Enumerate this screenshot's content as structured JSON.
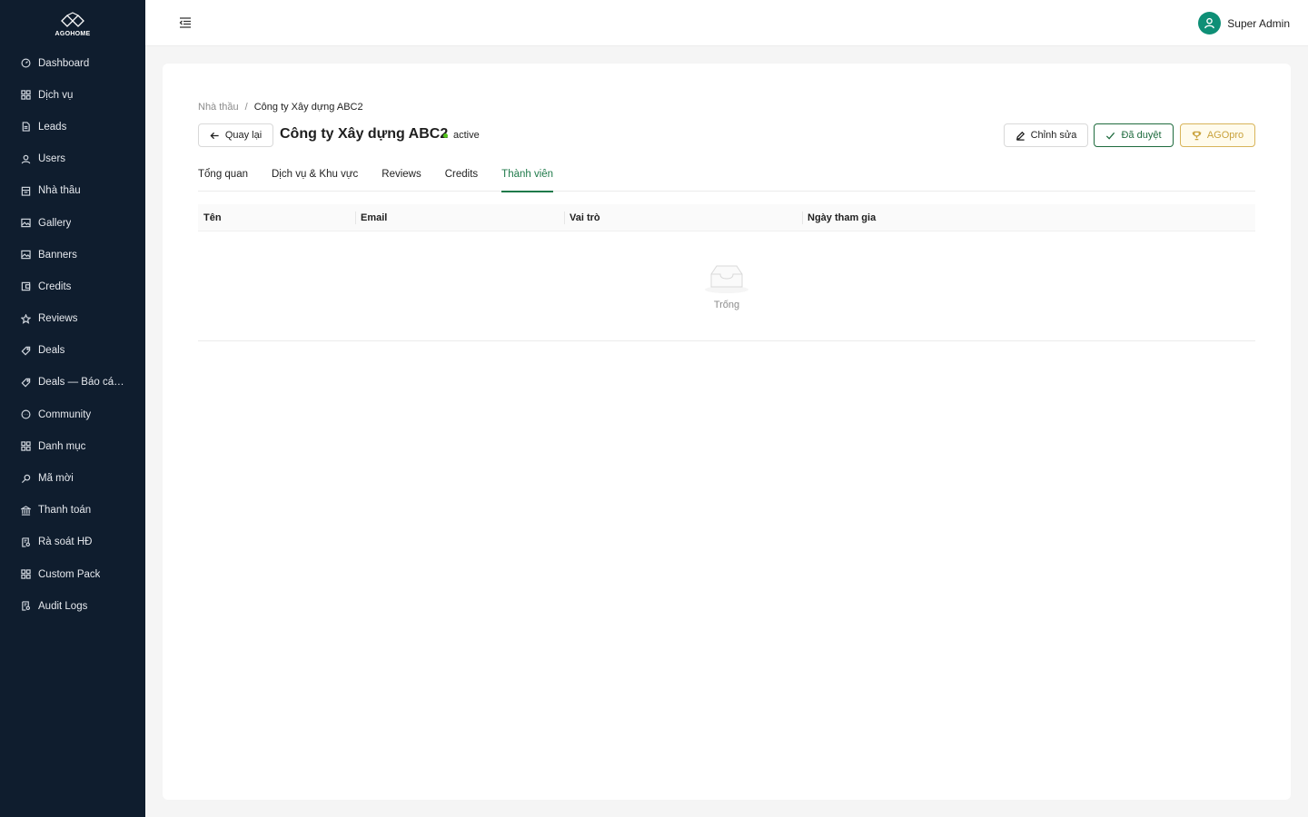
{
  "brand": {
    "name": "AGOHOME"
  },
  "sidebar": {
    "items": [
      {
        "label": "Dashboard",
        "icon": "dashboard-icon"
      },
      {
        "label": "Dịch vụ",
        "icon": "grid-icon"
      },
      {
        "label": "Leads",
        "icon": "file-icon"
      },
      {
        "label": "Users",
        "icon": "user-icon"
      },
      {
        "label": "Nhà thầu",
        "icon": "building-icon"
      },
      {
        "label": "Gallery",
        "icon": "image-icon"
      },
      {
        "label": "Banners",
        "icon": "image-icon"
      },
      {
        "label": "Credits",
        "icon": "wallet-icon"
      },
      {
        "label": "Reviews",
        "icon": "star-icon"
      },
      {
        "label": "Deals",
        "icon": "tag-icon"
      },
      {
        "label": "Deals — Báo cáo ...",
        "icon": "tag-icon"
      },
      {
        "label": "Community",
        "icon": "chat-icon"
      },
      {
        "label": "Danh mục",
        "icon": "grid-icon"
      },
      {
        "label": "Mã mời",
        "icon": "key-icon"
      },
      {
        "label": "Thanh toán",
        "icon": "bank-icon"
      },
      {
        "label": "Rà soát HĐ",
        "icon": "audit-icon"
      },
      {
        "label": "Custom Pack",
        "icon": "grid-icon"
      },
      {
        "label": "Audit Logs",
        "icon": "audit-icon"
      }
    ]
  },
  "header": {
    "user_name": "Super Admin"
  },
  "breadcrumb": {
    "parent": "Nhà thầu",
    "separator": "/",
    "current": "Công ty Xây dựng ABC2"
  },
  "page": {
    "back_label": "Quay lại",
    "title": "Công ty Xây dựng ABC2",
    "status": "active",
    "status_color": "#52c41a",
    "actions": {
      "edit": "Chỉnh sửa",
      "approved": "Đã duyệt",
      "agopro": "AGOpro"
    }
  },
  "tabs": [
    {
      "label": "Tổng quan",
      "active": false
    },
    {
      "label": "Dịch vụ & Khu vực",
      "active": false
    },
    {
      "label": "Reviews",
      "active": false
    },
    {
      "label": "Credits",
      "active": false
    },
    {
      "label": "Thành viên",
      "active": true
    }
  ],
  "table": {
    "columns": [
      "Tên",
      "Email",
      "Vai trò",
      "Ngày tham gia"
    ],
    "rows": [],
    "empty_text": "Trống"
  },
  "colors": {
    "sidebar_bg": "#0f1d2e",
    "accent": "#1f7a4a",
    "avatar": "#0e8f76",
    "agopro": "#c9a23c"
  }
}
